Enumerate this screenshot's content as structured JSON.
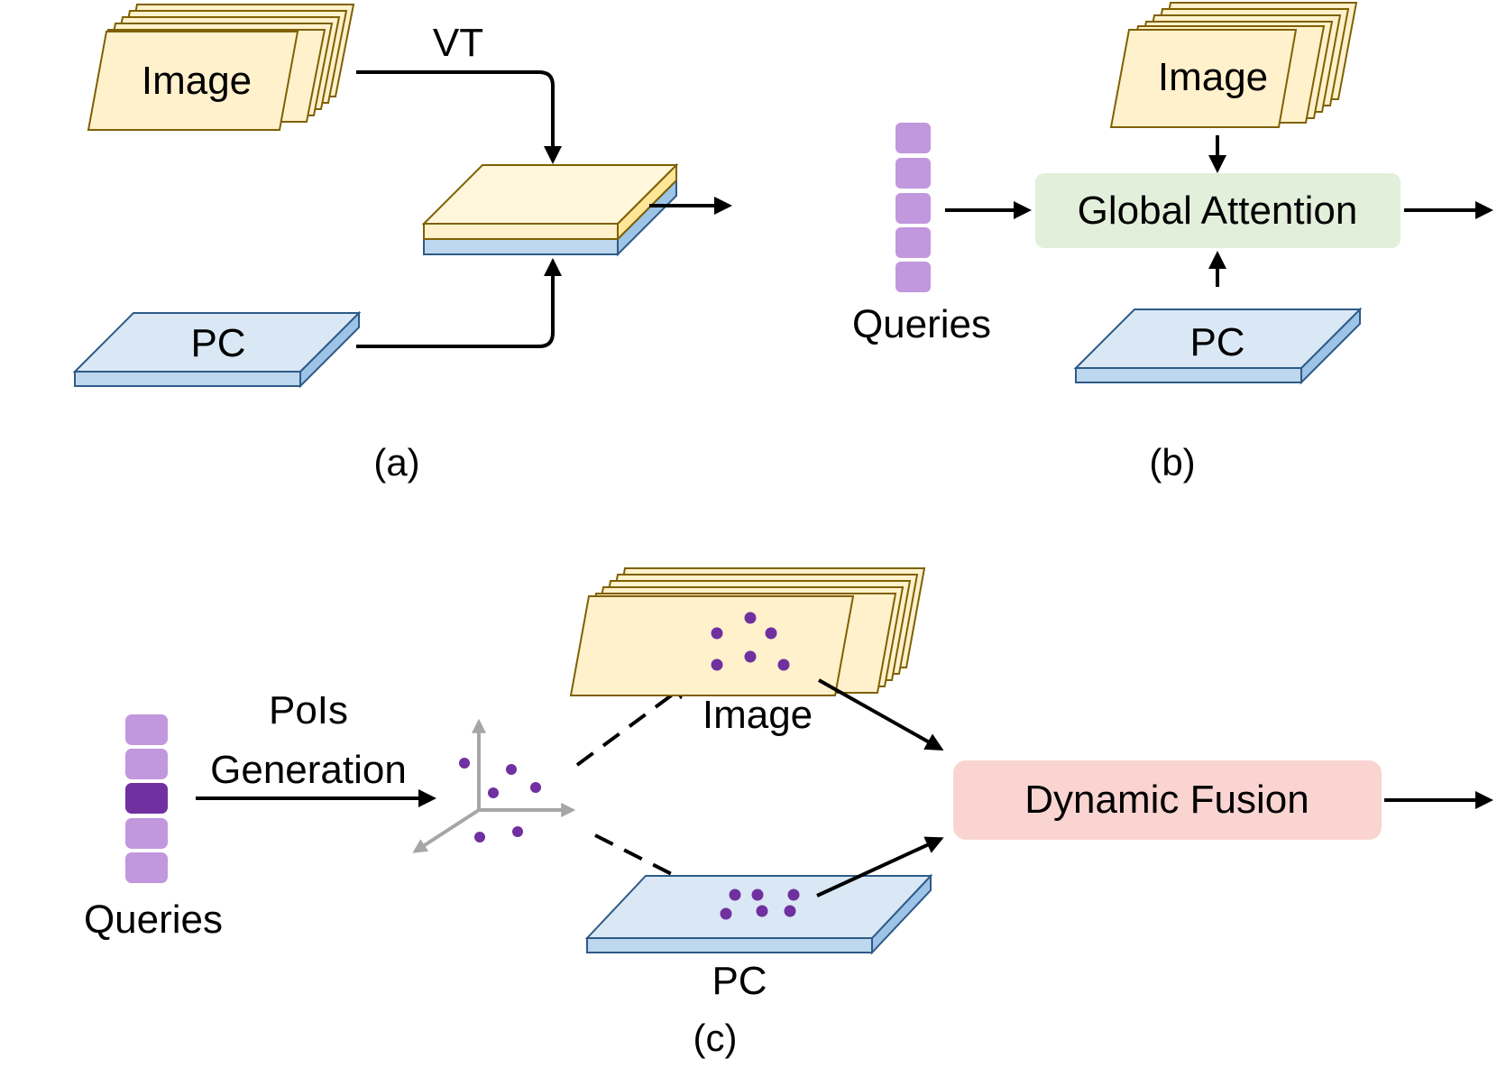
{
  "colors": {
    "image_fill": "#fff1cc",
    "image_stroke": "#7f6000",
    "image_side": "#ffe699",
    "pc_fill": "#dae8f5",
    "pc_stroke": "#2e5a88",
    "pc_side": "#9dc3e6",
    "pc_front": "#bdd7ee",
    "query_light": "#c197dd",
    "query_dark": "#7030a0",
    "point": "#7030a0",
    "axis": "#a6a6a6",
    "global_attention_bg": "#e2efda",
    "dynamic_fusion_bg": "#fad4d1"
  },
  "panel_a": {
    "image_label": "Image",
    "pc_label": "PC",
    "vt_label": "VT",
    "caption": "(a)"
  },
  "panel_b": {
    "image_label": "Image",
    "pc_label": "PC",
    "queries_label": "Queries",
    "attention_label": "Global Attention",
    "caption": "(b)"
  },
  "panel_c": {
    "image_label": "Image",
    "pc_label": "PC",
    "queries_label": "Queries",
    "pois_line1": "PoIs",
    "pois_line2": "Generation",
    "fusion_label": "Dynamic Fusion",
    "caption": "(c)"
  }
}
